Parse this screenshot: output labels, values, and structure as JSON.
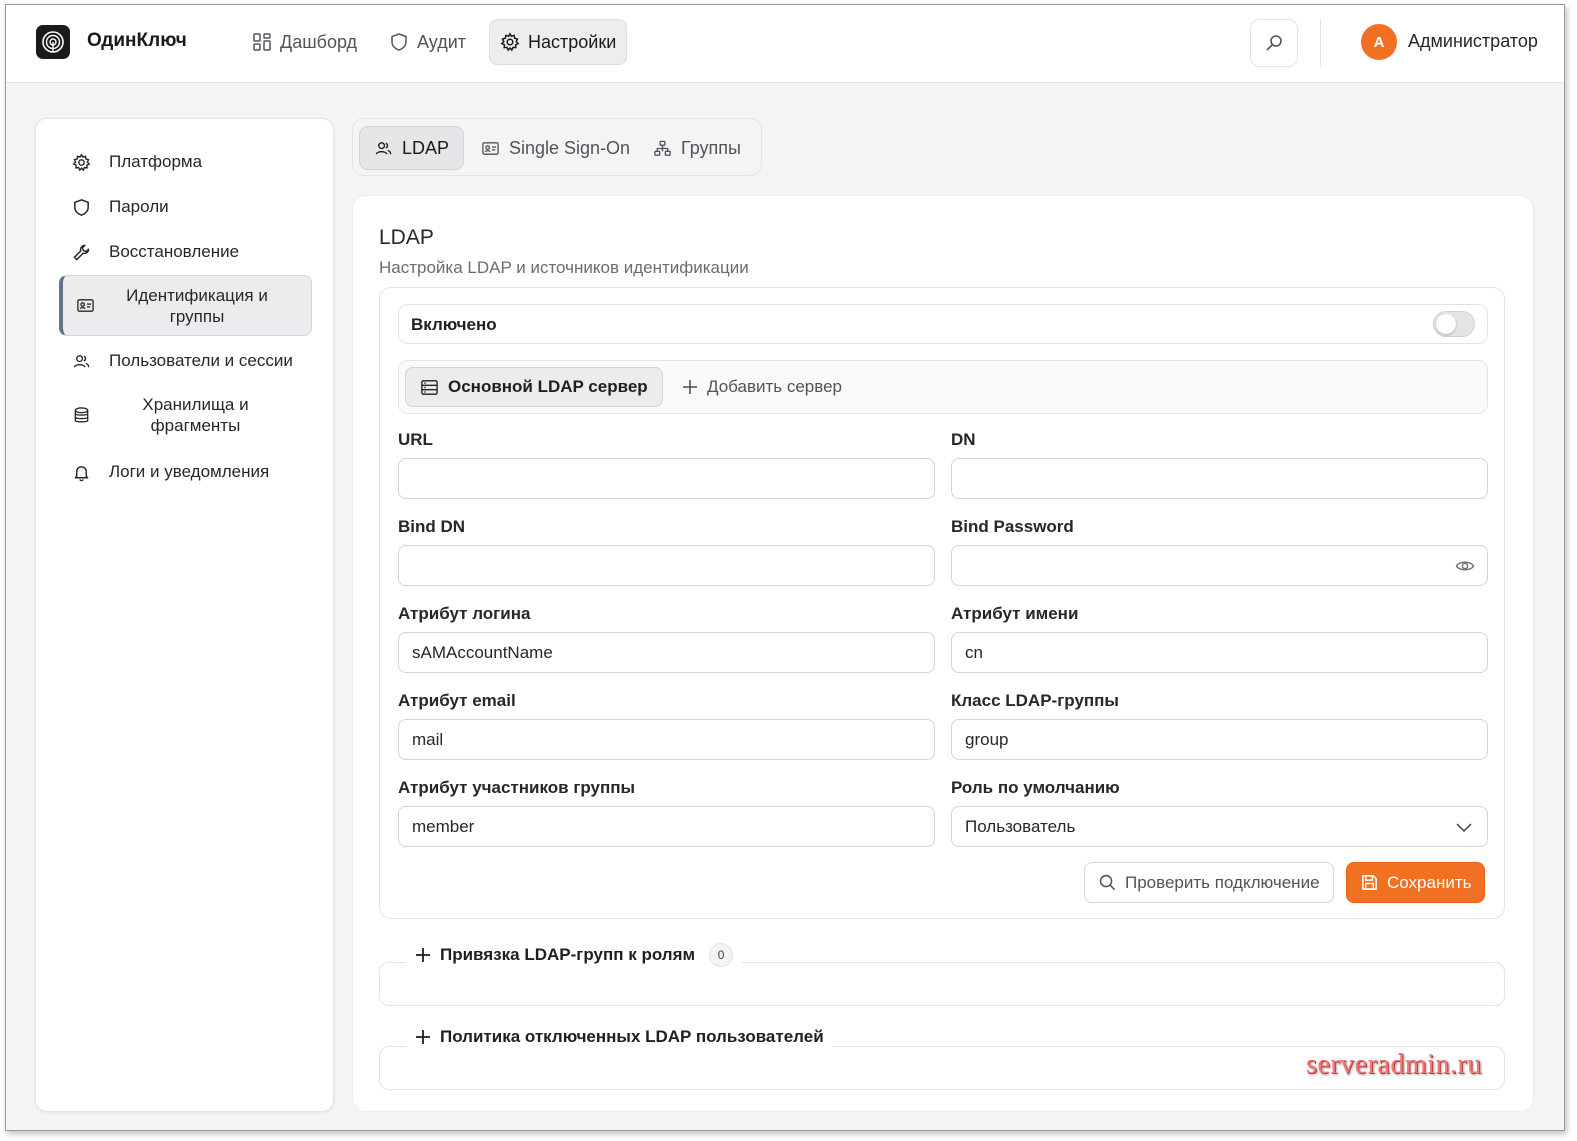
{
  "app": {
    "brand": "ОдинКлюч"
  },
  "nav": [
    {
      "label": "Дашборд",
      "icon": "dashboard-icon"
    },
    {
      "label": "Аудит",
      "icon": "shield-icon"
    },
    {
      "label": "Настройки",
      "icon": "gear-icon",
      "active": true
    }
  ],
  "user": {
    "initial": "А",
    "name": "Администратор"
  },
  "sidebar": {
    "items": [
      {
        "label": "Платформа",
        "icon": "gear-icon"
      },
      {
        "label": "Пароли",
        "icon": "shield-icon"
      },
      {
        "label": "Восстановление",
        "icon": "wrench-icon"
      },
      {
        "label": "Идентификация и группы",
        "icon": "id-card-icon",
        "active": true
      },
      {
        "label": "Пользователи и сессии",
        "icon": "users-icon"
      },
      {
        "label": "Хранилища и фрагменты",
        "icon": "database-icon"
      },
      {
        "label": "Логи и уведомления",
        "icon": "bell-icon"
      }
    ]
  },
  "tabs": [
    {
      "label": "LDAP",
      "icon": "users-icon",
      "active": true
    },
    {
      "label": "Single Sign-On",
      "icon": "id-card-icon"
    },
    {
      "label": "Группы",
      "icon": "network-icon"
    }
  ],
  "card": {
    "title": "LDAP",
    "subtitle": "Настройка LDAP и источников идентификации",
    "enabled_label": "Включено",
    "enabled": false,
    "server_tab": "Основной LDAP сервер",
    "add_server": "Добавить сервер",
    "fields": {
      "url": {
        "label": "URL",
        "value": ""
      },
      "dn": {
        "label": "DN",
        "value": ""
      },
      "bind_dn": {
        "label": "Bind DN",
        "value": ""
      },
      "bind_password": {
        "label": "Bind Password",
        "value": ""
      },
      "login_attr": {
        "label": "Атрибут логина",
        "value": "sAMAccountName"
      },
      "name_attr": {
        "label": "Атрибут имени",
        "value": "cn"
      },
      "email_attr": {
        "label": "Атрибут email",
        "value": "mail"
      },
      "group_class": {
        "label": "Класс LDAP-группы",
        "value": "group"
      },
      "member_attr": {
        "label": "Атрибут участников группы",
        "value": "member"
      },
      "default_role": {
        "label": "Роль по умолчанию",
        "value": "Пользователь"
      }
    },
    "test_button": "Проверить подключение",
    "save_button": "Сохранить",
    "save_color": "#f27021"
  },
  "sections": [
    {
      "title": "Привязка LDAP-групп к ролям",
      "count": "0"
    },
    {
      "title": "Политика отключенных LDAP пользователей"
    }
  ],
  "watermark": "serveradmin.ru"
}
